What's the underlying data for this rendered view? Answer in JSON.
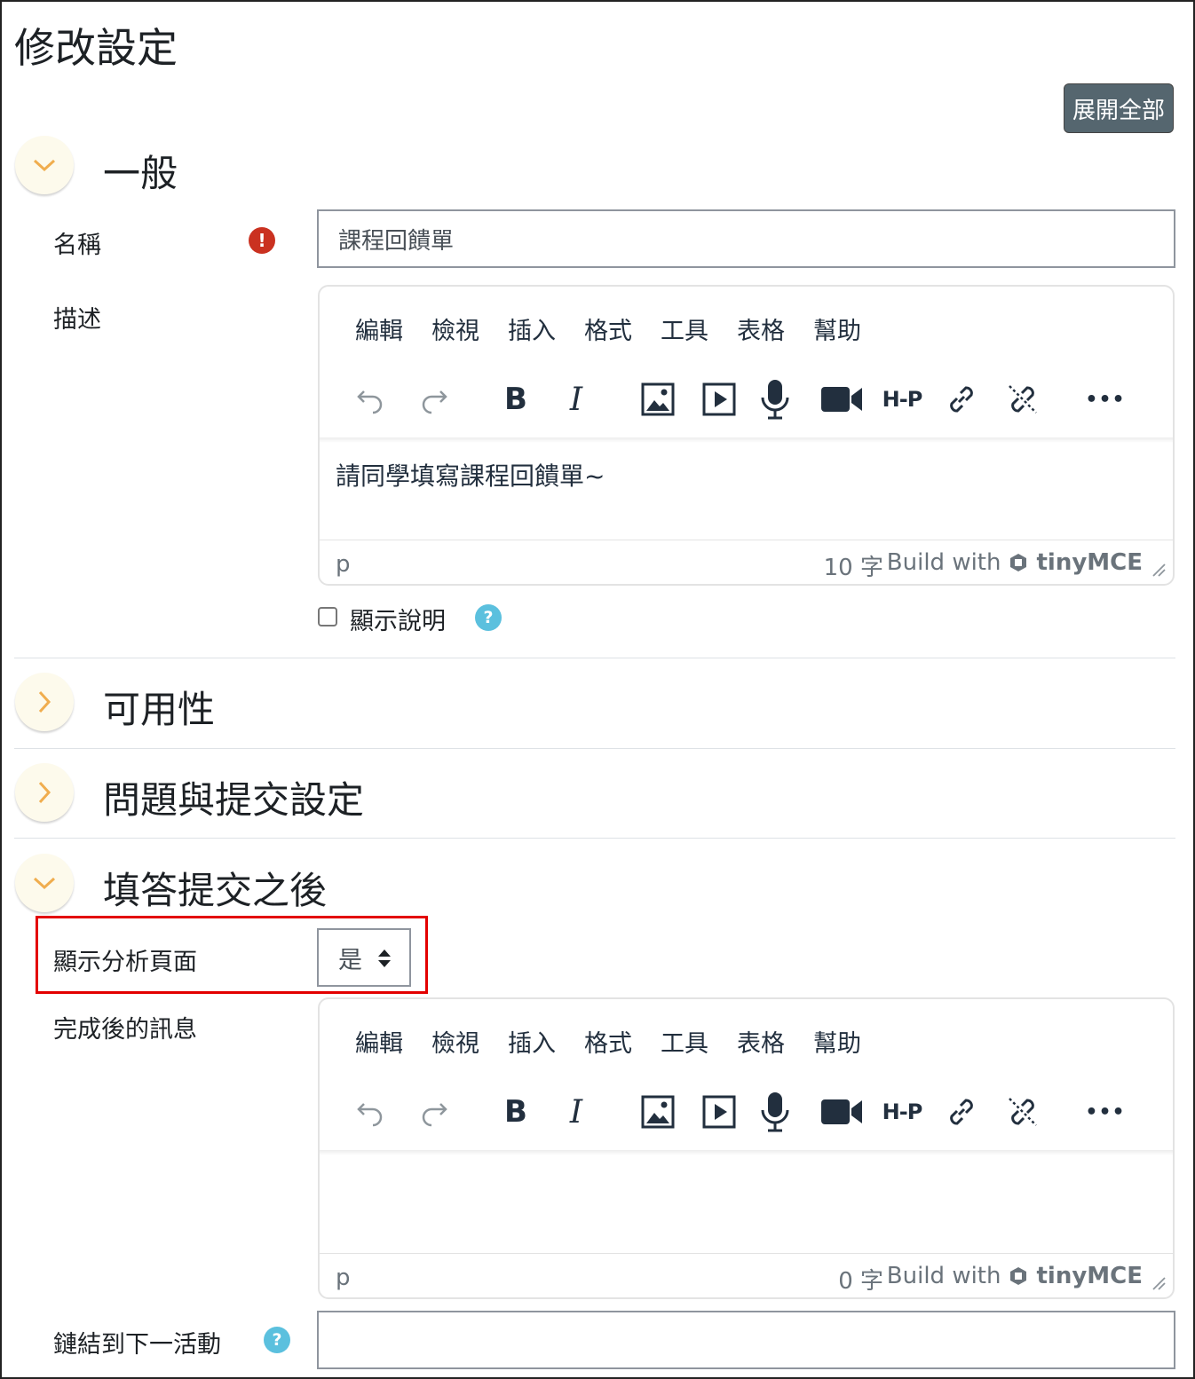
{
  "page": {
    "title": "修改設定",
    "expand_all": "展開全部"
  },
  "sections": {
    "general": {
      "title": "一般"
    },
    "availability": {
      "title": "可用性"
    },
    "questions": {
      "title": "問題與提交設定"
    },
    "after_submit": {
      "title": "填答提交之後"
    }
  },
  "fields": {
    "name": {
      "label": "名稱",
      "value": "課程回饋單",
      "required_icon": "exclamation-icon"
    },
    "description": {
      "label": "描述"
    },
    "show_description": {
      "label": "顯示說明",
      "checked": false,
      "help_icon": "question-icon"
    },
    "show_analysis": {
      "label": "顯示分析頁面",
      "value": "是"
    },
    "completion_message": {
      "label": "完成後的訊息"
    },
    "next_activity": {
      "label": "鏈結到下一活動",
      "value": "",
      "help_icon": "question-icon"
    }
  },
  "editor": {
    "menu": [
      "編輯",
      "檢視",
      "插入",
      "格式",
      "工具",
      "表格",
      "幫助"
    ],
    "toolbar_icons": [
      "undo-icon",
      "redo-icon",
      "bold-icon",
      "italic-icon",
      "image-icon",
      "media-icon",
      "microphone-icon",
      "video-camera-icon",
      "h5p-icon",
      "link-icon",
      "unlink-icon",
      "more-icon"
    ],
    "bold_glyph": "B",
    "italic_glyph": "I",
    "h5p_glyph": "H-P",
    "more_glyph": "•••",
    "build_with": "Build with",
    "brand": "tinyMCE"
  },
  "editor_description": {
    "content": "請同學填寫課程回饋單~",
    "path": "p",
    "word_count": "10 字"
  },
  "editor_completion": {
    "content": "",
    "path": "p",
    "word_count": "0 字"
  },
  "colors": {
    "accent_toggle": "#f0ad4e",
    "expand_button": "#55666f",
    "error": "#ca3120",
    "help": "#5bc0de",
    "highlight": "#e30000"
  }
}
